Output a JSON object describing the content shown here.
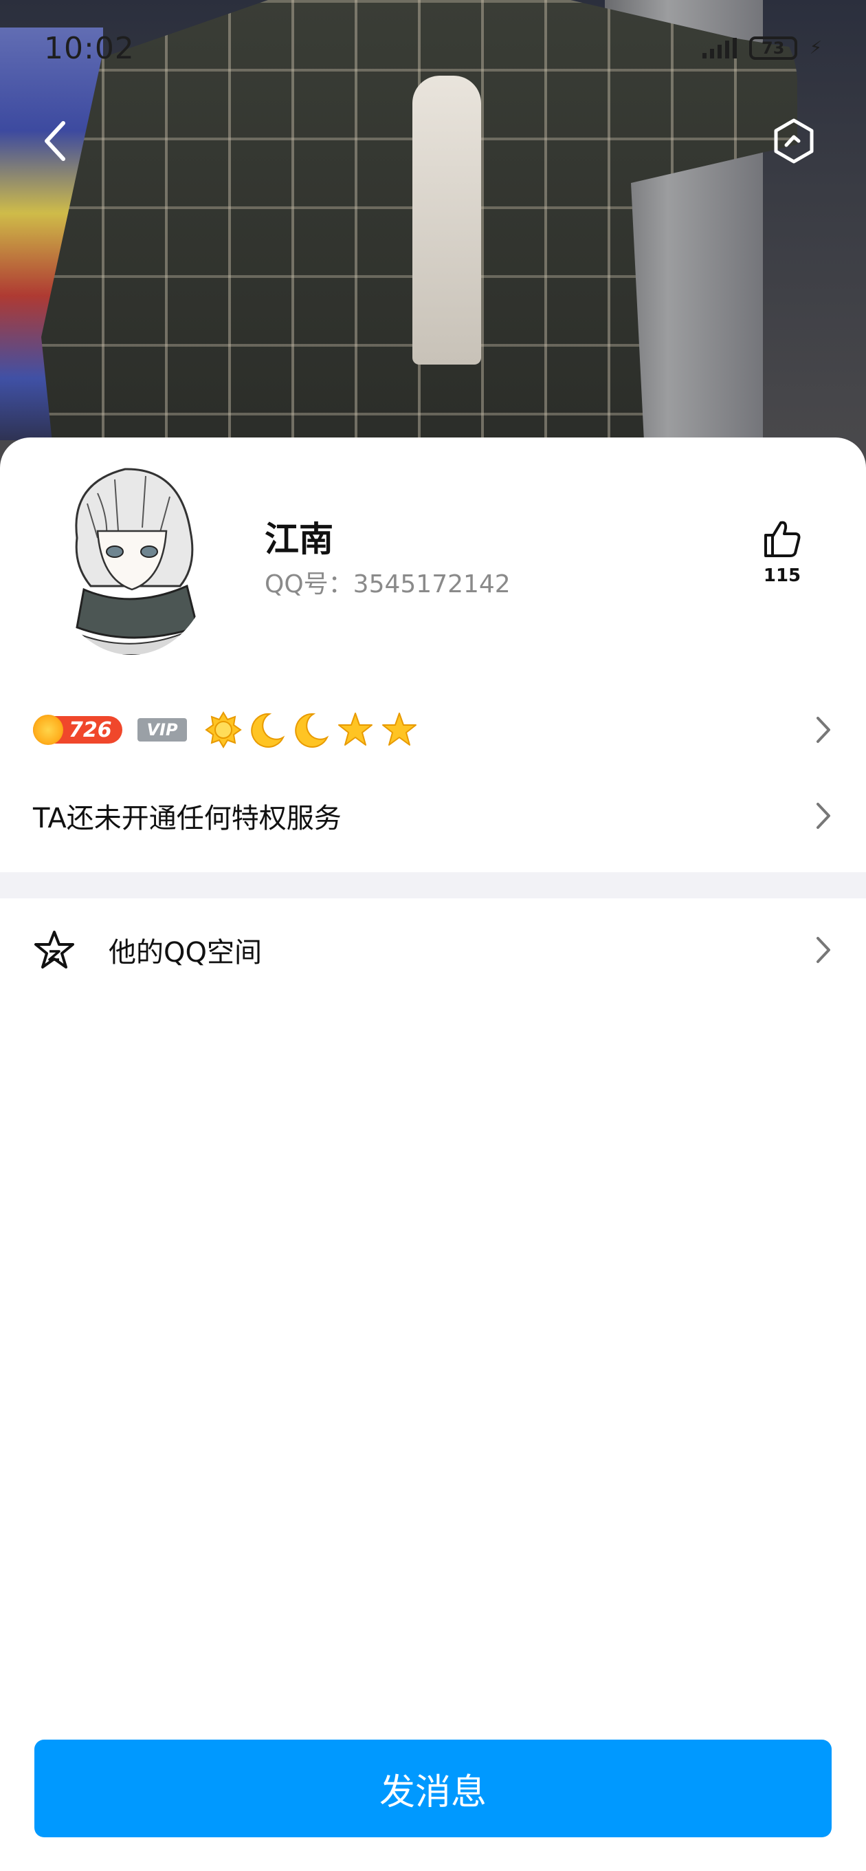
{
  "status_bar": {
    "time": "10:02",
    "battery": "73"
  },
  "header": {
    "back_icon": "chevron-left-icon",
    "settings_icon": "hexagon-icon"
  },
  "profile": {
    "nickname": "江南",
    "qq_label": "QQ号：3545172142",
    "like_count": "115"
  },
  "level": {
    "value": "726",
    "vip_text": "VIP",
    "icons": [
      "sun-icon",
      "moon-icon",
      "moon-icon",
      "star-icon",
      "star-icon"
    ]
  },
  "privilege": {
    "text": "TA还未开通任何特权服务"
  },
  "qzone": {
    "label": "他的QQ空间"
  },
  "actions": {
    "send_message": "发消息"
  },
  "colors": {
    "primary_button": "#0099ff",
    "level_badge": "#f0472b",
    "divider": "#f2f2f6"
  }
}
